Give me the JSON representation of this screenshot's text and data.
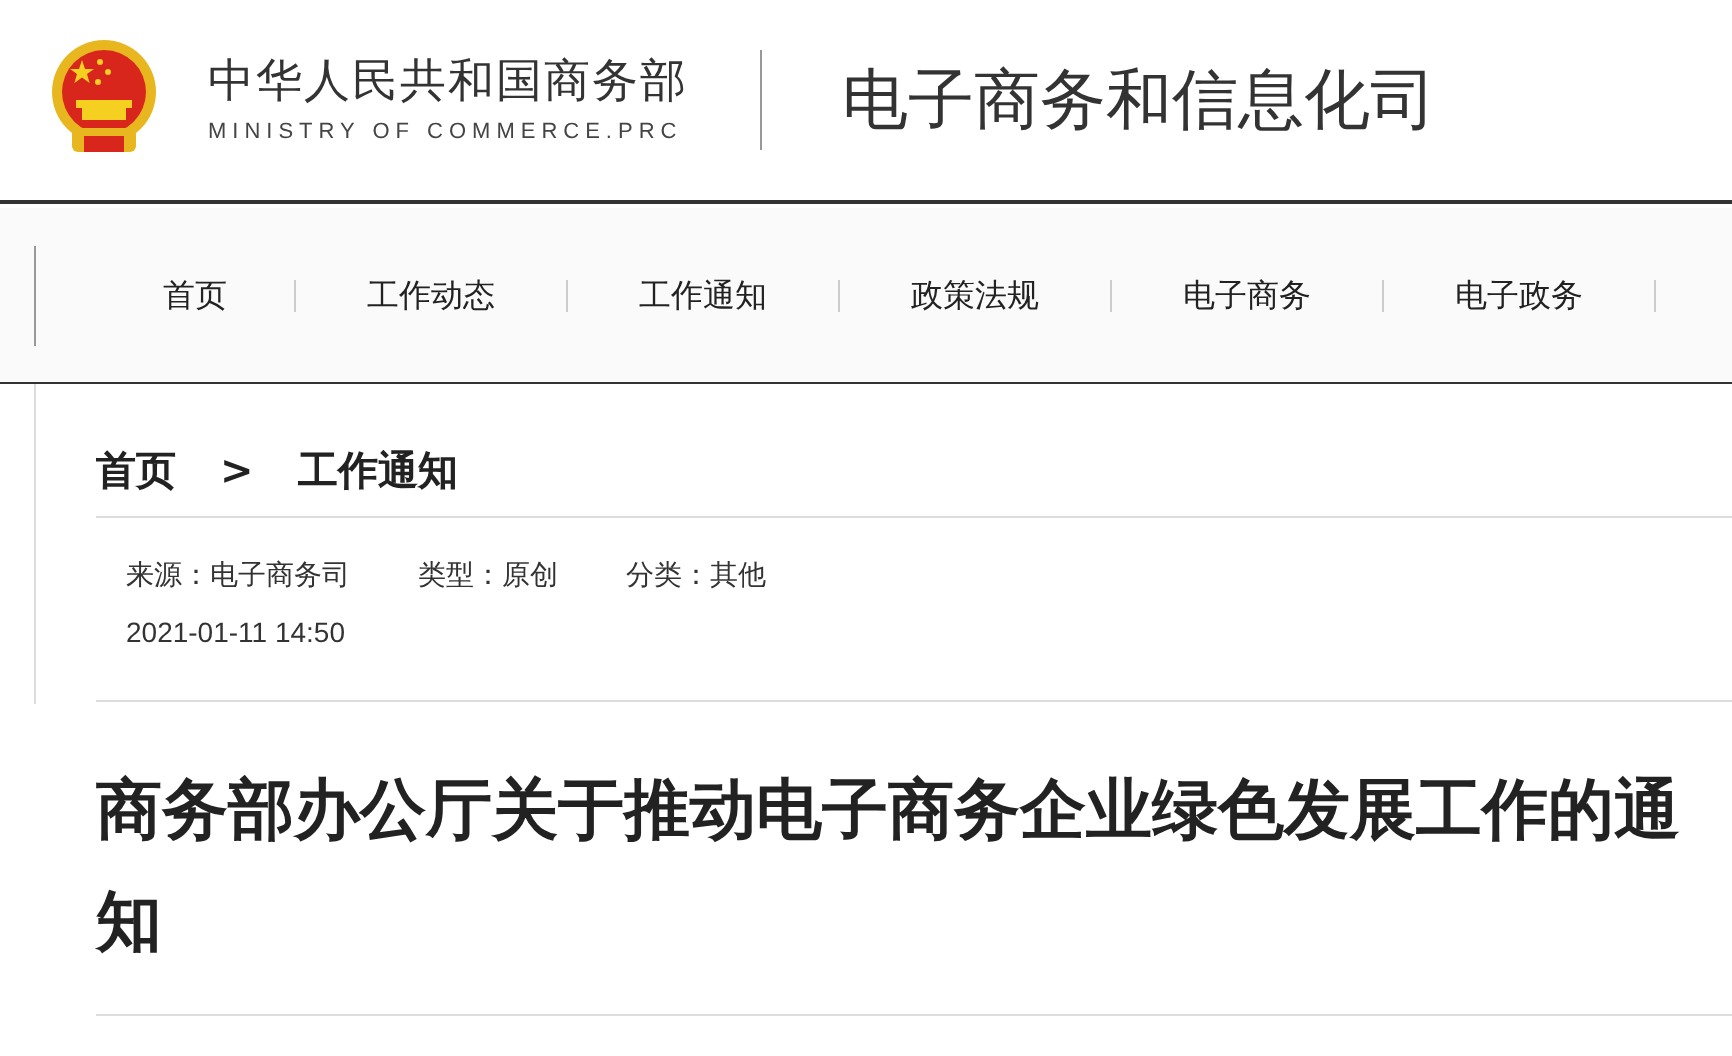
{
  "header": {
    "org_name": "中华人民共和国商务部",
    "org_name_en": "MINISTRY OF COMMERCE.PRC",
    "department": "电子商务和信息化司"
  },
  "nav": {
    "items": [
      {
        "label": "首页"
      },
      {
        "label": "工作动态"
      },
      {
        "label": "工作通知"
      },
      {
        "label": "政策法规"
      },
      {
        "label": "电子商务"
      },
      {
        "label": "电子政务"
      }
    ]
  },
  "breadcrumb": [
    {
      "label": "首页"
    },
    {
      "label": "工作通知"
    }
  ],
  "breadcrumb_separator": ">",
  "meta": [
    {
      "text": "来源：电子商务司"
    },
    {
      "text": "类型：原创"
    },
    {
      "text": "分类：其他"
    }
  ],
  "date": "2021-01-11 14:50",
  "article_title": "商务部办公厅关于推动电子商务企业绿色发展工作的通知"
}
